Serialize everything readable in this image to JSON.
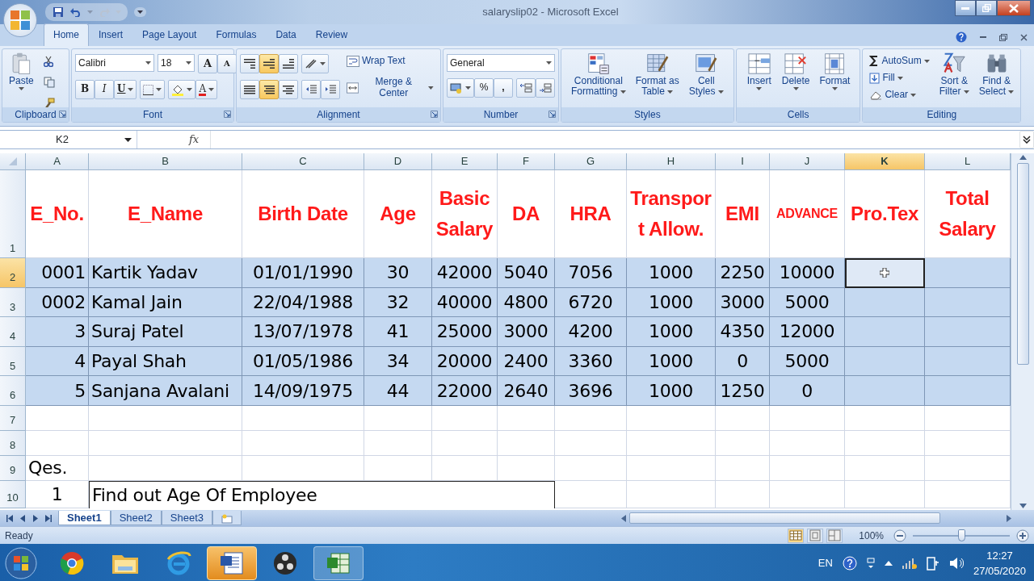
{
  "window": {
    "title": "salaryslip02 - Microsoft Excel"
  },
  "ribbon_tabs": [
    {
      "label": "Home",
      "selected": true
    },
    {
      "label": "Insert",
      "selected": false
    },
    {
      "label": "Page Layout",
      "selected": false
    },
    {
      "label": "Formulas",
      "selected": false
    },
    {
      "label": "Data",
      "selected": false
    },
    {
      "label": "Review",
      "selected": false
    }
  ],
  "ribbon_groups": [
    {
      "kind": "clipboard",
      "label": "Clipboard",
      "paste": "Paste"
    },
    {
      "kind": "font",
      "label": "Font",
      "font_name": "Calibri",
      "font_size": "18",
      "grow": "A",
      "shrink": "A",
      "bold": "B",
      "italic": "I",
      "underline": "U",
      "font_color": "A"
    },
    {
      "kind": "alignment",
      "label": "Alignment",
      "vertical": [
        {
          "selected": false
        },
        {
          "selected": true
        },
        {
          "selected": false
        }
      ],
      "horizontal": [
        {
          "selected": false
        },
        {
          "selected": true
        },
        {
          "selected": false
        }
      ],
      "wrap_text": "Wrap Text",
      "merge": "Merge & Center"
    },
    {
      "kind": "number",
      "label": "Number",
      "format": "General",
      "percent": "%",
      "comma": ","
    },
    {
      "kind": "large",
      "label": "Styles",
      "buttons": [
        {
          "kind": "conditional",
          "lines": [
            "Conditional",
            "Formatting"
          ]
        },
        {
          "kind": "table",
          "lines": [
            "Format as",
            "Table"
          ]
        },
        {
          "kind": "styles",
          "lines": [
            "Cell",
            "Styles"
          ]
        }
      ]
    },
    {
      "kind": "large",
      "label": "Cells",
      "buttons": [
        {
          "kind": "insert",
          "lines": [
            "Insert"
          ]
        },
        {
          "kind": "delete",
          "lines": [
            "Delete"
          ]
        },
        {
          "kind": "format",
          "lines": [
            "Format"
          ]
        }
      ]
    },
    {
      "kind": "editing",
      "label": "Editing",
      "small": [
        {
          "kind": "autosum",
          "label": "AutoSum"
        },
        {
          "kind": "fill",
          "label": "Fill"
        },
        {
          "kind": "clear",
          "label": "Clear"
        }
      ],
      "buttons": [
        {
          "kind": "sort",
          "lines": [
            "Sort &",
            "Filter"
          ]
        },
        {
          "kind": "find",
          "lines": [
            "Find &",
            "Select"
          ]
        }
      ]
    }
  ],
  "formula_bar": {
    "name_box": "K2",
    "fx": "fx"
  },
  "sheet": {
    "columns": [
      {
        "label": "A",
        "selected": false
      },
      {
        "label": "B",
        "selected": false
      },
      {
        "label": "C",
        "selected": false
      },
      {
        "label": "D",
        "selected": false
      },
      {
        "label": "E",
        "selected": false
      },
      {
        "label": "F",
        "selected": false
      },
      {
        "label": "G",
        "selected": false
      },
      {
        "label": "H",
        "selected": false
      },
      {
        "label": "I",
        "selected": false
      },
      {
        "label": "J",
        "selected": false
      },
      {
        "label": "K",
        "selected": true
      },
      {
        "label": "L",
        "selected": false
      }
    ],
    "rows": [
      {
        "number": "1",
        "kind": "header",
        "selected": false,
        "shaded": false,
        "cells": [
          "E_No.",
          "E_Name",
          "Birth Date",
          "Age",
          "Basic Salary",
          "DA",
          "HRA",
          "Transport Allow.",
          "EMI",
          {
            "text": "ADVANCE",
            "small": true
          },
          "Pro.Tex",
          "Total Salary"
        ]
      },
      {
        "number": "2",
        "kind": "data",
        "selected": true,
        "shaded": true,
        "cells": [
          "0001",
          "Kartik Yadav",
          "01/01/1990",
          "30",
          "42000",
          "5040",
          "7056",
          "1000",
          "2250",
          "10000",
          {
            "selected": true
          },
          null
        ]
      },
      {
        "number": "3",
        "kind": "data",
        "selected": false,
        "shaded": true,
        "cells": [
          "0002",
          "Kamal Jain",
          "22/04/1988",
          "32",
          "40000",
          "4800",
          "6720",
          "1000",
          "3000",
          "5000",
          null,
          null
        ]
      },
      {
        "number": "4",
        "kind": "data",
        "selected": false,
        "shaded": true,
        "cells": [
          "3",
          "Suraj Patel",
          "13/07/1978",
          "41",
          "25000",
          "3000",
          "4200",
          "1000",
          "4350",
          "12000",
          null,
          null
        ]
      },
      {
        "number": "5",
        "kind": "data",
        "selected": false,
        "shaded": true,
        "cells": [
          "4",
          "Payal Shah",
          "01/05/1986",
          "34",
          "20000",
          "2400",
          "3360",
          "1000",
          "0",
          "5000",
          null,
          null
        ]
      },
      {
        "number": "6",
        "kind": "data",
        "selected": false,
        "shaded": true,
        "cells": [
          "5",
          "Sanjana Avalani",
          "14/09/1975",
          "44",
          "22000",
          "2640",
          "3696",
          "1000",
          "1250",
          "0",
          null,
          null
        ]
      },
      {
        "number": "7",
        "kind": "blank",
        "selected": false,
        "shaded": false,
        "cells": [
          null,
          null,
          null,
          null,
          null,
          null,
          null,
          null,
          null,
          null,
          null,
          null
        ]
      },
      {
        "number": "8",
        "kind": "blank",
        "selected": false,
        "shaded": false,
        "cells": [
          null,
          null,
          null,
          null,
          null,
          null,
          null,
          null,
          null,
          null,
          null,
          null
        ]
      },
      {
        "number": "9",
        "kind": "label",
        "selected": false,
        "shaded": false,
        "cells": [
          "Qes.",
          null,
          null,
          null,
          null,
          null,
          null,
          null,
          null,
          null,
          null,
          null
        ]
      },
      {
        "number": "10",
        "kind": "question",
        "selected": false,
        "shaded": false,
        "cells": [
          "1",
          "Find out Age Of Employee",
          null,
          null,
          null,
          null,
          null,
          null
        ]
      }
    ]
  },
  "sheet_tabs": [
    {
      "label": "Sheet1",
      "selected": true
    },
    {
      "label": "Sheet2",
      "selected": false
    },
    {
      "label": "Sheet3",
      "selected": false
    }
  ],
  "status_bar": {
    "status": "Ready",
    "views": [
      {
        "kind": "normal",
        "selected": true
      },
      {
        "kind": "page_layout",
        "selected": false
      },
      {
        "kind": "page_break",
        "selected": false
      }
    ],
    "zoom": "100%",
    "zoom_slider": {
      "level": 0.5
    }
  },
  "taskbar": {
    "items": [
      {
        "kind": "browser",
        "flashing": false,
        "active": false
      },
      {
        "kind": "folder",
        "flashing": false,
        "active": false
      },
      {
        "kind": "web",
        "flashing": false,
        "active": false
      },
      {
        "kind": "document",
        "flashing": true,
        "active": false
      },
      {
        "kind": "recorder",
        "flashing": false,
        "active": false
      },
      {
        "kind": "spreadsheet",
        "flashing": false,
        "active": true
      }
    ],
    "language": "EN",
    "time": "12:27",
    "date": "27/05/2020"
  }
}
